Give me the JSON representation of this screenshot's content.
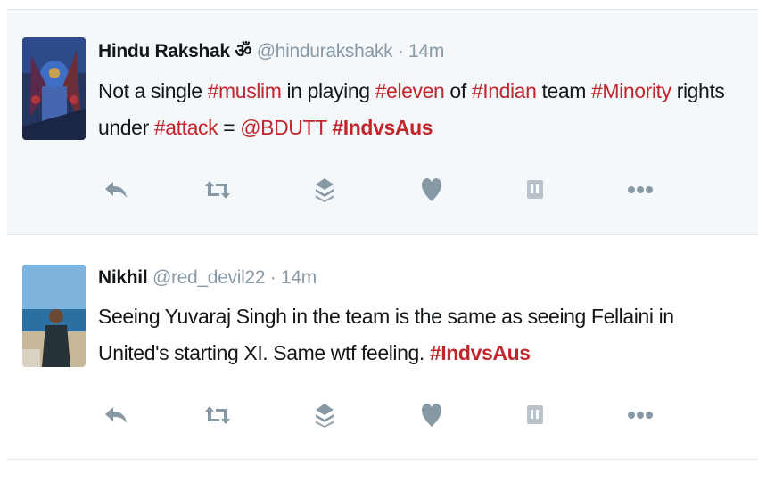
{
  "tweets": [
    {
      "name": "Hindu Rakshak ॐ",
      "handle": "@hindurakshakk",
      "time": "· 14m",
      "text": [
        {
          "t": "Not a single ",
          "type": "text"
        },
        {
          "t": "#muslim",
          "type": "tag"
        },
        {
          "t": " in playing ",
          "type": "text"
        },
        {
          "t": "#eleven",
          "type": "tag"
        },
        {
          "t": " of ",
          "type": "text"
        },
        {
          "t": "#Indian",
          "type": "tag"
        },
        {
          "t": " team ",
          "type": "text"
        },
        {
          "t": "#Minority",
          "type": "tag"
        },
        {
          "t": " rights under ",
          "type": "text"
        },
        {
          "t": "#attack",
          "type": "tag"
        },
        {
          "t": "  = ",
          "type": "text"
        },
        {
          "t": "@BDUTT",
          "type": "tag"
        },
        {
          "t": "  ",
          "type": "text"
        },
        {
          "t": "#IndvsAus",
          "type": "tagbold"
        }
      ]
    },
    {
      "name": "Nikhil",
      "handle": "@red_devil22",
      "time": "· 14m",
      "text": [
        {
          "t": "Seeing Yuvaraj Singh in the team is the same as seeing Fellaini in United's starting XI. Same wtf feeling. ",
          "type": "text"
        },
        {
          "t": "#IndvsAus",
          "type": "tagbold"
        }
      ]
    }
  ],
  "actions": [
    "reply-icon",
    "retweet-icon",
    "stack-icon",
    "heart-icon",
    "poll-icon",
    "more-icon"
  ],
  "colors": {
    "hashtag": "#c0272d",
    "icon": "#8899a6",
    "meta": "#8899a6"
  }
}
